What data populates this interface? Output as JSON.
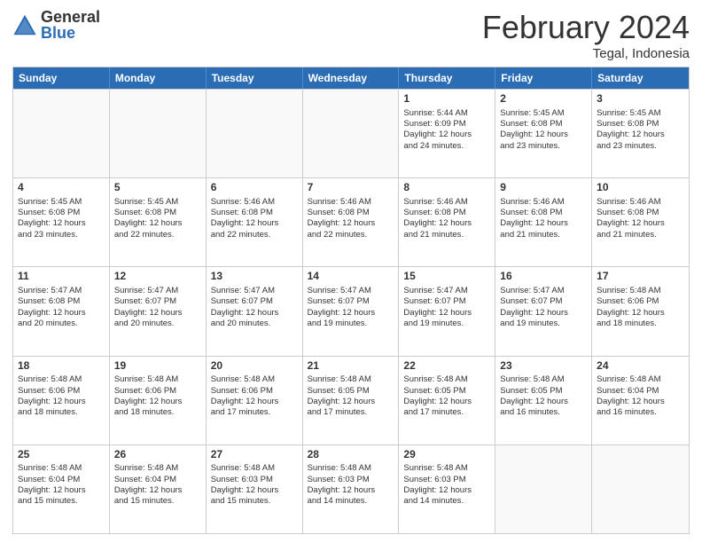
{
  "logo": {
    "general": "General",
    "blue": "Blue"
  },
  "title": "February 2024",
  "location": "Tegal, Indonesia",
  "days": [
    "Sunday",
    "Monday",
    "Tuesday",
    "Wednesday",
    "Thursday",
    "Friday",
    "Saturday"
  ],
  "rows": [
    [
      {
        "day": "",
        "info": ""
      },
      {
        "day": "",
        "info": ""
      },
      {
        "day": "",
        "info": ""
      },
      {
        "day": "",
        "info": ""
      },
      {
        "day": "1",
        "info": "Sunrise: 5:44 AM\nSunset: 6:09 PM\nDaylight: 12 hours\nand 24 minutes."
      },
      {
        "day": "2",
        "info": "Sunrise: 5:45 AM\nSunset: 6:08 PM\nDaylight: 12 hours\nand 23 minutes."
      },
      {
        "day": "3",
        "info": "Sunrise: 5:45 AM\nSunset: 6:08 PM\nDaylight: 12 hours\nand 23 minutes."
      }
    ],
    [
      {
        "day": "4",
        "info": "Sunrise: 5:45 AM\nSunset: 6:08 PM\nDaylight: 12 hours\nand 23 minutes."
      },
      {
        "day": "5",
        "info": "Sunrise: 5:45 AM\nSunset: 6:08 PM\nDaylight: 12 hours\nand 22 minutes."
      },
      {
        "day": "6",
        "info": "Sunrise: 5:46 AM\nSunset: 6:08 PM\nDaylight: 12 hours\nand 22 minutes."
      },
      {
        "day": "7",
        "info": "Sunrise: 5:46 AM\nSunset: 6:08 PM\nDaylight: 12 hours\nand 22 minutes."
      },
      {
        "day": "8",
        "info": "Sunrise: 5:46 AM\nSunset: 6:08 PM\nDaylight: 12 hours\nand 21 minutes."
      },
      {
        "day": "9",
        "info": "Sunrise: 5:46 AM\nSunset: 6:08 PM\nDaylight: 12 hours\nand 21 minutes."
      },
      {
        "day": "10",
        "info": "Sunrise: 5:46 AM\nSunset: 6:08 PM\nDaylight: 12 hours\nand 21 minutes."
      }
    ],
    [
      {
        "day": "11",
        "info": "Sunrise: 5:47 AM\nSunset: 6:08 PM\nDaylight: 12 hours\nand 20 minutes."
      },
      {
        "day": "12",
        "info": "Sunrise: 5:47 AM\nSunset: 6:07 PM\nDaylight: 12 hours\nand 20 minutes."
      },
      {
        "day": "13",
        "info": "Sunrise: 5:47 AM\nSunset: 6:07 PM\nDaylight: 12 hours\nand 20 minutes."
      },
      {
        "day": "14",
        "info": "Sunrise: 5:47 AM\nSunset: 6:07 PM\nDaylight: 12 hours\nand 19 minutes."
      },
      {
        "day": "15",
        "info": "Sunrise: 5:47 AM\nSunset: 6:07 PM\nDaylight: 12 hours\nand 19 minutes."
      },
      {
        "day": "16",
        "info": "Sunrise: 5:47 AM\nSunset: 6:07 PM\nDaylight: 12 hours\nand 19 minutes."
      },
      {
        "day": "17",
        "info": "Sunrise: 5:48 AM\nSunset: 6:06 PM\nDaylight: 12 hours\nand 18 minutes."
      }
    ],
    [
      {
        "day": "18",
        "info": "Sunrise: 5:48 AM\nSunset: 6:06 PM\nDaylight: 12 hours\nand 18 minutes."
      },
      {
        "day": "19",
        "info": "Sunrise: 5:48 AM\nSunset: 6:06 PM\nDaylight: 12 hours\nand 18 minutes."
      },
      {
        "day": "20",
        "info": "Sunrise: 5:48 AM\nSunset: 6:06 PM\nDaylight: 12 hours\nand 17 minutes."
      },
      {
        "day": "21",
        "info": "Sunrise: 5:48 AM\nSunset: 6:05 PM\nDaylight: 12 hours\nand 17 minutes."
      },
      {
        "day": "22",
        "info": "Sunrise: 5:48 AM\nSunset: 6:05 PM\nDaylight: 12 hours\nand 17 minutes."
      },
      {
        "day": "23",
        "info": "Sunrise: 5:48 AM\nSunset: 6:05 PM\nDaylight: 12 hours\nand 16 minutes."
      },
      {
        "day": "24",
        "info": "Sunrise: 5:48 AM\nSunset: 6:04 PM\nDaylight: 12 hours\nand 16 minutes."
      }
    ],
    [
      {
        "day": "25",
        "info": "Sunrise: 5:48 AM\nSunset: 6:04 PM\nDaylight: 12 hours\nand 15 minutes."
      },
      {
        "day": "26",
        "info": "Sunrise: 5:48 AM\nSunset: 6:04 PM\nDaylight: 12 hours\nand 15 minutes."
      },
      {
        "day": "27",
        "info": "Sunrise: 5:48 AM\nSunset: 6:03 PM\nDaylight: 12 hours\nand 15 minutes."
      },
      {
        "day": "28",
        "info": "Sunrise: 5:48 AM\nSunset: 6:03 PM\nDaylight: 12 hours\nand 14 minutes."
      },
      {
        "day": "29",
        "info": "Sunrise: 5:48 AM\nSunset: 6:03 PM\nDaylight: 12 hours\nand 14 minutes."
      },
      {
        "day": "",
        "info": ""
      },
      {
        "day": "",
        "info": ""
      }
    ]
  ]
}
